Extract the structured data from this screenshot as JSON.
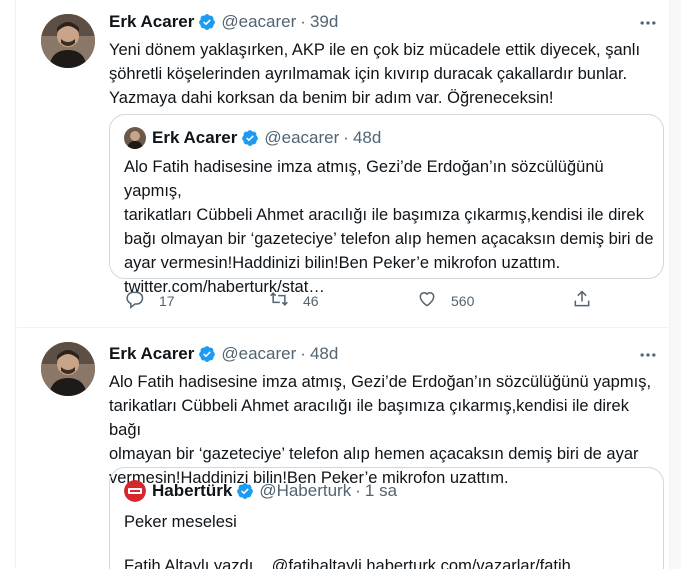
{
  "colors": {
    "text": "#0f1419",
    "muted": "#536471",
    "verified": "#1d9bf0",
    "border": "#cfd9de",
    "brand_red": "#d8262e"
  },
  "tweets": [
    {
      "author": {
        "name": "Erk Acarer",
        "handle": "@eacarer",
        "separator": "·",
        "time": "39d",
        "verified_icon": "verified-badge-icon"
      },
      "text": "Yeni dönem yaklaşırken, AKP ile en çok biz mücadele ettik diyecek, şanlı\nşöhretli köşelerinden ayrılmamak için kıvırıp duracak çakallardır bunlar.\nYazmaya dahi korksan da benim bir adım var. Öğreneceksin!",
      "quote": {
        "author": {
          "name": "Erk Acarer",
          "handle": "@eacarer",
          "separator": "·",
          "time": "48d"
        },
        "text": "Alo Fatih hadisesine imza atmış, Gezi’de Erdoğan’ın sözcülüğünü yapmış,\ntarikatları Cübbeli Ahmet aracılığı ile başımıza çıkarmış,kendisi ile direk\nbağı olmayan bir ‘gazeteciye’ telefon alıp hemen açacaksın demiş biri de\nayar vermesin!Haddinizi bilin!Ben Peker’e mikrofon uzattım.\ntwitter.com/haberturk/stat…"
      },
      "actions": {
        "replies": "17",
        "retweets": "46",
        "likes": "560"
      }
    },
    {
      "author": {
        "name": "Erk Acarer",
        "handle": "@eacarer",
        "separator": "·",
        "time": "48d",
        "verified_icon": "verified-badge-icon"
      },
      "text": "Alo Fatih hadisesine imza atmış, Gezi’de Erdoğan’ın sözcülüğünü yapmış,\ntarikatları Cübbeli Ahmet aracılığı ile başımıza çıkarmış,kendisi ile direk bağı\nolmayan bir ‘gazeteciye’ telefon alıp hemen açacaksın demiş biri de ayar\nvermesin!Haddinizi bilin!Ben Peker’e mikrofon uzattım.",
      "quote": {
        "author": {
          "name": "Habertürk",
          "handle": "@Haberturk",
          "separator": "·",
          "time": "1 sa"
        },
        "line1": "Peker meselesi",
        "line2": "Fatih Altaylı yazdı... @fatihaltayli haberturk.com/vazarlar/fatih..."
      }
    }
  ]
}
